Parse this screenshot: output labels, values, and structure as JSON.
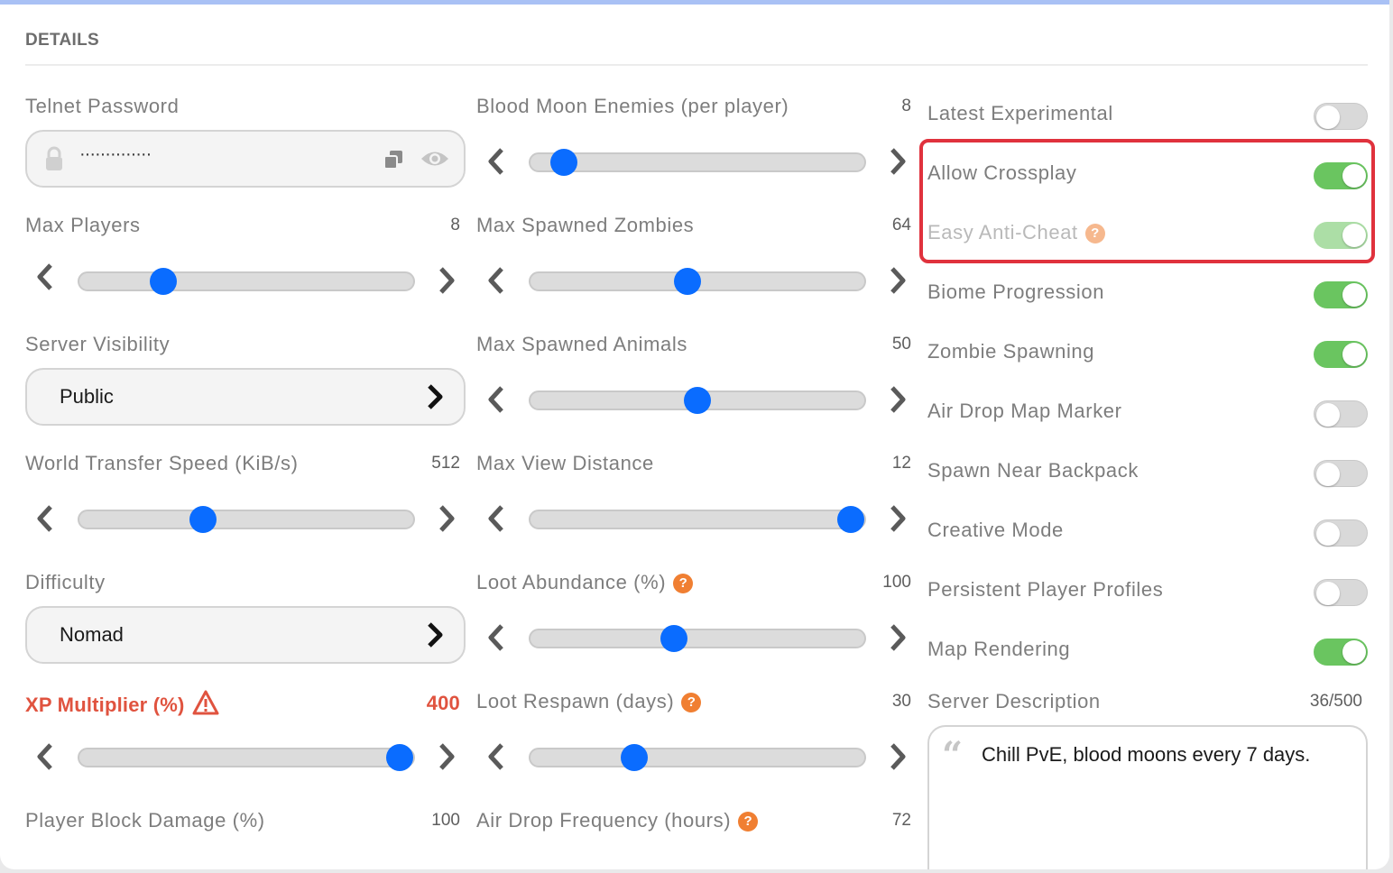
{
  "header": {
    "title": "DETAILS"
  },
  "telnet": {
    "label": "Telnet Password",
    "value": "··············"
  },
  "sliders": [
    {
      "label": "Max Players",
      "value": "8",
      "level": 0.25
    },
    {
      "label": "World Transfer Speed (KiB/s)",
      "value": "512",
      "level": 0.37
    },
    {
      "label": "XP Multiplier (%)",
      "value": "400",
      "level": 0.96,
      "warning": true
    },
    {
      "label": "Player Block Damage (%)",
      "value": "100"
    },
    {
      "label": "Blood Moon Enemies (per player)",
      "value": "8",
      "level": 0.1
    },
    {
      "label": "Max Spawned Zombies",
      "value": "64",
      "level": 0.47
    },
    {
      "label": "Max Spawned Animals",
      "value": "50",
      "level": 0.5
    },
    {
      "label": "Max View Distance",
      "value": "12",
      "level": 0.96
    },
    {
      "label": "Loot Abundance (%)",
      "value": "100",
      "level": 0.43,
      "help": true
    },
    {
      "label": "Loot Respawn (days)",
      "value": "30",
      "level": 0.31,
      "help": true
    },
    {
      "label": "Air Drop Frequency (hours)",
      "value": "72",
      "help": true
    }
  ],
  "selects": [
    {
      "label": "Server Visibility",
      "value": "Public"
    },
    {
      "label": "Difficulty",
      "value": "Nomad"
    }
  ],
  "toggles": [
    {
      "label": "Latest Experimental",
      "on": false
    },
    {
      "label": "Allow Crossplay",
      "on": true
    },
    {
      "label": "Easy Anti-Cheat",
      "on": true,
      "disabled": true,
      "help": true
    },
    {
      "label": "Biome Progression",
      "on": true
    },
    {
      "label": "Zombie Spawning",
      "on": true
    },
    {
      "label": "Air Drop Map Marker",
      "on": false
    },
    {
      "label": "Spawn Near Backpack",
      "on": false
    },
    {
      "label": "Creative Mode",
      "on": false
    },
    {
      "label": "Persistent Player Profiles",
      "on": false
    },
    {
      "label": "Map Rendering",
      "on": true
    }
  ],
  "description": {
    "label": "Server Description",
    "count": "36/500",
    "text": "Chill PvE, blood moons every 7 days."
  },
  "icons": {
    "lock": "lock-icon",
    "copy": "copy-icon",
    "eye": "eye-icon",
    "left": "chevron-left-icon",
    "right": "chevron-right-icon",
    "help": "help-icon",
    "warning": "warning-icon",
    "quote": "quote-icon"
  },
  "colors": {
    "accent": "#0a6cff",
    "toggle_on": "#6ac560",
    "warning": "#e0533f",
    "help": "#f07f32",
    "highlight": "#e0323d",
    "top_bar": "#a9c1f5"
  }
}
